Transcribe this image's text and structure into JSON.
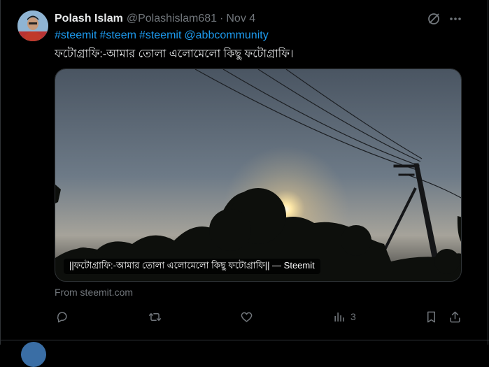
{
  "tweet": {
    "author_name": "Polash Islam",
    "handle": "@Polashislam681",
    "separator": "·",
    "date": "Nov 4",
    "hashtags": [
      "#steemit",
      "#steem",
      "#steemit",
      "@abbcommunity"
    ],
    "text": "ফটোগ্রাফি:-আমার তোলা এলোমেলো কিছু ফটোগ্রাফি।",
    "card": {
      "caption": "||ফটোগ্রাফি:-আমার তোলা এলোমেলো কিছু ফটোগ্রাফি|| — Steemit",
      "source": "From steemit.com"
    },
    "actions": {
      "views_count": "3"
    }
  },
  "icons": {
    "grok": "grok-icon",
    "more": "more-icon",
    "reply": "reply-icon",
    "retweet": "retweet-icon",
    "like": "heart-icon",
    "views": "views-icon",
    "bookmark": "bookmark-icon",
    "share": "share-icon"
  },
  "colors": {
    "background": "#000000",
    "text": "#e7e9ea",
    "secondary": "#71767b",
    "link": "#1d9bf0",
    "border": "#2f3336"
  }
}
